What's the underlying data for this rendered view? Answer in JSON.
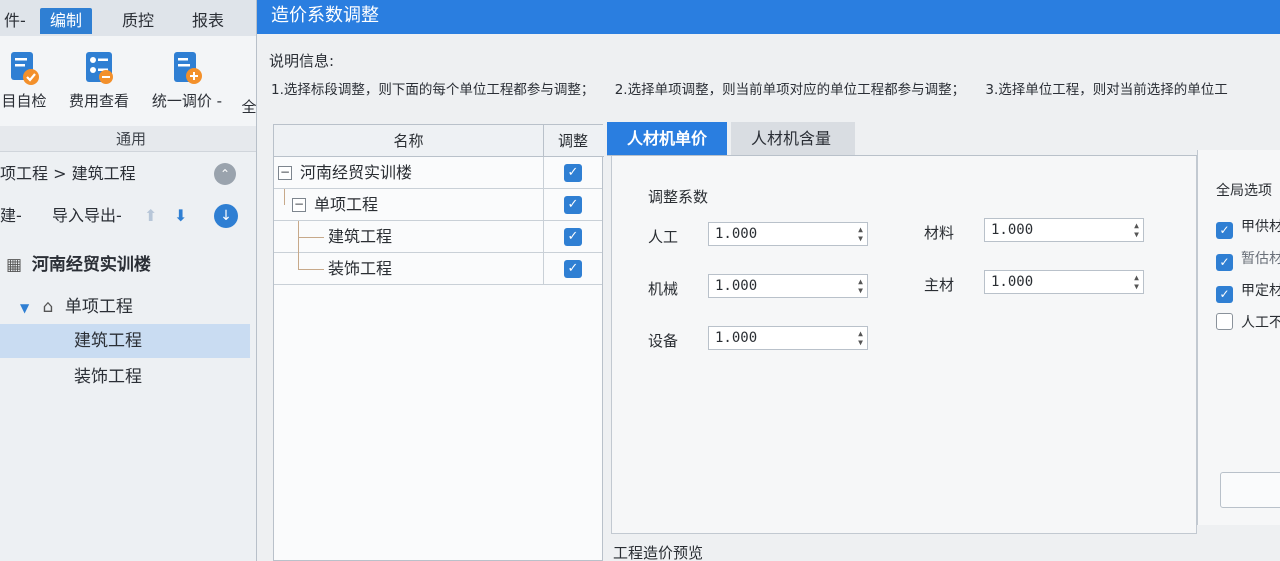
{
  "app": {
    "menu": [
      {
        "label": "件-",
        "active": false
      },
      {
        "label": "编制",
        "active": true
      },
      {
        "label": "质控",
        "active": false
      },
      {
        "label": "报表",
        "active": false
      }
    ],
    "ribbon_buttons": [
      {
        "label": "目自检",
        "icon": "self-check-icon"
      },
      {
        "label": "费用查看",
        "icon": "cost-view-icon"
      },
      {
        "label": "统一调价 -",
        "icon": "unified-price-icon"
      },
      {
        "label": "全",
        "icon": ""
      }
    ],
    "ribbon_group": "通用",
    "breadcrumb": "项工程 > 建筑工程",
    "toolbar": {
      "new": "建-",
      "import_export": "导入导出-"
    },
    "tree": {
      "root": "河南经贸实训楼",
      "child": "单项工程",
      "leaves": [
        "建筑工程",
        "装饰工程"
      ],
      "selected": "建筑工程"
    }
  },
  "dialog": {
    "title": "造价系数调整",
    "desc_label": "说明信息:",
    "desc_items": [
      "1.选择标段调整，则下面的每个单位工程都参与调整；",
      "2.选择单项调整，则当前单项对应的单位工程都参与调整；",
      "3.选择单位工程，则对当前选择的单位工"
    ],
    "grid": {
      "col_name": "名称",
      "col_adjust": "调整",
      "rows": [
        {
          "name": "河南经贸实训楼",
          "checked": true
        },
        {
          "name": "单项工程",
          "checked": true
        },
        {
          "name": "建筑工程",
          "checked": true
        },
        {
          "name": "装饰工程",
          "checked": true
        }
      ]
    },
    "tabs": [
      {
        "label": "人材机单价",
        "active": true
      },
      {
        "label": "人材机含量",
        "active": false
      }
    ],
    "coef": {
      "title": "调整系数",
      "labor": {
        "label": "人工",
        "value": "1.000"
      },
      "material": {
        "label": "材料",
        "value": "1.000"
      },
      "machine": {
        "label": "机械",
        "value": "1.000"
      },
      "main_material": {
        "label": "主材",
        "value": "1.000"
      },
      "equipment": {
        "label": "设备",
        "value": "1.000"
      }
    },
    "global": {
      "title": "全局选项",
      "options": [
        {
          "label": "甲供材",
          "checked": true
        },
        {
          "label": "暂估材",
          "checked": true
        },
        {
          "label": "甲定材",
          "checked": true
        },
        {
          "label": "人工不",
          "checked": false
        }
      ]
    },
    "preview_label": "工程造价预览"
  },
  "colors": {
    "accent": "#2a7ee0",
    "selected_row": "#c9dcf2"
  }
}
